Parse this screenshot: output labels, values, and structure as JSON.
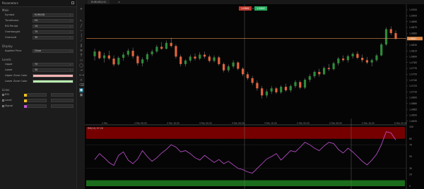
{
  "sidebar": {
    "title": "Parameters",
    "sections": [
      {
        "label": "Main",
        "rows": [
          {
            "label": "Symbol",
            "value": "EURUSD"
          },
          {
            "label": "Timeframe",
            "value": "H1"
          },
          {
            "label": "RSI Period",
            "value": "14"
          },
          {
            "label": "Overbought",
            "value": "70"
          },
          {
            "label": "Oversold",
            "value": "30"
          }
        ]
      },
      {
        "label": "Display",
        "rows": [
          {
            "label": "Applied Price",
            "value": "Close"
          }
        ]
      },
      {
        "label": "Levels",
        "rows": [
          {
            "label": "Upper",
            "value": "70"
          },
          {
            "label": "Lower",
            "value": "30"
          },
          {
            "label": "Upper Zone Color",
            "value": ""
          },
          {
            "label": "Lower Zone Color",
            "value": ""
          }
        ]
      },
      {
        "label": "Lines",
        "rows": [
          {
            "label": "RSI",
            "value": ""
          },
          {
            "label": "Level",
            "value": ""
          },
          {
            "label": "Signal",
            "value": ""
          }
        ]
      }
    ]
  },
  "tab": {
    "label": "EURUSD,H1",
    "close": "×"
  },
  "trade": {
    "sell": "1.0841",
    "buy": "1.0842",
    "spread": "1"
  },
  "indicator_label": "RSI(14) 57.20",
  "price_axis": [
    "1.0920",
    "1.0905",
    "1.0890",
    "1.0875",
    "1.0860",
    "1.0845",
    "1.0830",
    "1.0815",
    "1.0800",
    "1.0785",
    "1.0770",
    "1.0755",
    "1.0740",
    "1.0725",
    "1.0710",
    "1.0695",
    "1.0680",
    "1.0665",
    "1.0650",
    "1.0635"
  ],
  "current_price": "1.0841",
  "rsi_axis": [
    "100",
    "80",
    "70",
    "50",
    "30",
    "20",
    "0"
  ],
  "time_axis": [
    "2 Feb",
    "3 Feb 08:00",
    "3 Feb 16:00",
    "4 Feb 00:00",
    "4 Feb 08:00",
    "4 Feb 16:00",
    "5 Feb 00:00",
    "5 Feb 08:00",
    "5 Feb 16:00",
    "6 Feb 00:00"
  ],
  "colors": {
    "up": "#2e8b3a",
    "down": "#e2643c",
    "rsi": "#c452d6",
    "overbought": "#8b0000",
    "oversold": "#1e7a1e",
    "priceline": "#e08a4a"
  },
  "chart_data": {
    "type": "candlestick",
    "candles": [
      [
        1.0796,
        1.0815,
        1.0785,
        1.0808
      ],
      [
        1.0808,
        1.0811,
        1.0788,
        1.0791
      ],
      [
        1.0791,
        1.0805,
        1.078,
        1.0798
      ],
      [
        1.0798,
        1.081,
        1.0786,
        1.079
      ],
      [
        1.079,
        1.0798,
        1.077,
        1.0775
      ],
      [
        1.0775,
        1.0796,
        1.0772,
        1.0792
      ],
      [
        1.0792,
        1.0806,
        1.0785,
        1.08
      ],
      [
        1.08,
        1.0815,
        1.0795,
        1.081
      ],
      [
        1.081,
        1.0818,
        1.079,
        1.0796
      ],
      [
        1.0796,
        1.08,
        1.0772,
        1.0778
      ],
      [
        1.0778,
        1.0793,
        1.077,
        1.0788
      ],
      [
        1.0788,
        1.0806,
        1.0782,
        1.0801
      ],
      [
        1.0801,
        1.0813,
        1.0796,
        1.0808
      ],
      [
        1.0808,
        1.0825,
        1.0804,
        1.082
      ],
      [
        1.082,
        1.0832,
        1.0812,
        1.0815
      ],
      [
        1.0815,
        1.0836,
        1.0813,
        1.083
      ],
      [
        1.083,
        1.0843,
        1.0818,
        1.0822
      ],
      [
        1.0822,
        1.0826,
        1.079,
        1.0795
      ],
      [
        1.0795,
        1.08,
        1.077,
        1.0776
      ],
      [
        1.0776,
        1.0788,
        1.077,
        1.0785
      ],
      [
        1.0785,
        1.08,
        1.078,
        1.0795
      ],
      [
        1.0795,
        1.0803,
        1.0785,
        1.079
      ],
      [
        1.079,
        1.0806,
        1.0786,
        1.08
      ],
      [
        1.08,
        1.0808,
        1.079,
        1.0795
      ],
      [
        1.0795,
        1.08,
        1.078,
        1.0784
      ],
      [
        1.0784,
        1.0798,
        1.078,
        1.0793
      ],
      [
        1.0793,
        1.0797,
        1.0772,
        1.0776
      ],
      [
        1.0776,
        1.078,
        1.0755,
        1.076
      ],
      [
        1.076,
        1.0775,
        1.0755,
        1.077
      ],
      [
        1.077,
        1.0786,
        1.0765,
        1.078
      ],
      [
        1.078,
        1.0783,
        1.076,
        1.0764
      ],
      [
        1.0764,
        1.0768,
        1.0745,
        1.075
      ],
      [
        1.075,
        1.0756,
        1.0735,
        1.074
      ],
      [
        1.074,
        1.0746,
        1.0722,
        1.0728
      ],
      [
        1.0728,
        1.0734,
        1.0708,
        1.0714
      ],
      [
        1.0714,
        1.072,
        1.0688,
        1.0696
      ],
      [
        1.0696,
        1.0712,
        1.069,
        1.0706
      ],
      [
        1.0706,
        1.072,
        1.07,
        1.0714
      ],
      [
        1.0714,
        1.0718,
        1.07,
        1.0704
      ],
      [
        1.0704,
        1.0722,
        1.07,
        1.0718
      ],
      [
        1.0718,
        1.0726,
        1.0705,
        1.0709
      ],
      [
        1.0709,
        1.0724,
        1.0704,
        1.072
      ],
      [
        1.072,
        1.0735,
        1.0715,
        1.073
      ],
      [
        1.073,
        1.0734,
        1.0712,
        1.0716
      ],
      [
        1.0716,
        1.074,
        1.0712,
        1.0736
      ],
      [
        1.0736,
        1.075,
        1.073,
        1.0745
      ],
      [
        1.0745,
        1.076,
        1.074,
        1.0756
      ],
      [
        1.0756,
        1.0764,
        1.0744,
        1.075
      ],
      [
        1.075,
        1.077,
        1.0748,
        1.0766
      ],
      [
        1.0766,
        1.0776,
        1.0758,
        1.0763
      ],
      [
        1.0763,
        1.0782,
        1.076,
        1.0778
      ],
      [
        1.0778,
        1.0794,
        1.0772,
        1.079
      ],
      [
        1.079,
        1.0798,
        1.0782,
        1.0786
      ],
      [
        1.0786,
        1.08,
        1.078,
        1.0796
      ],
      [
        1.0796,
        1.0806,
        1.079,
        1.0802
      ],
      [
        1.0802,
        1.0808,
        1.0788,
        1.0792
      ],
      [
        1.0792,
        1.08,
        1.078,
        1.0786
      ],
      [
        1.0786,
        1.0794,
        1.0776,
        1.078
      ],
      [
        1.078,
        1.079,
        1.077,
        1.0786
      ],
      [
        1.0786,
        1.0802,
        1.0782,
        1.0798
      ],
      [
        1.0798,
        1.083,
        1.0796,
        1.0826
      ],
      [
        1.0826,
        1.087,
        1.0822,
        1.0865
      ],
      [
        1.0865,
        1.0872,
        1.085,
        1.0855
      ],
      [
        1.0855,
        1.0862,
        1.0838,
        1.0841
      ]
    ],
    "rsi": [
      45,
      55,
      48,
      40,
      35,
      52,
      58,
      44,
      38,
      46,
      60,
      50,
      42,
      48,
      56,
      62,
      70,
      66,
      58,
      60,
      55,
      48,
      44,
      52,
      46,
      40,
      45,
      38,
      42,
      36,
      30,
      28,
      24,
      22,
      30,
      38,
      46,
      50,
      55,
      44,
      52,
      60,
      58,
      66,
      74,
      70,
      64,
      60,
      68,
      74,
      72,
      62,
      56,
      64,
      58,
      50,
      42,
      36,
      44,
      54,
      70,
      92,
      90,
      78
    ]
  }
}
